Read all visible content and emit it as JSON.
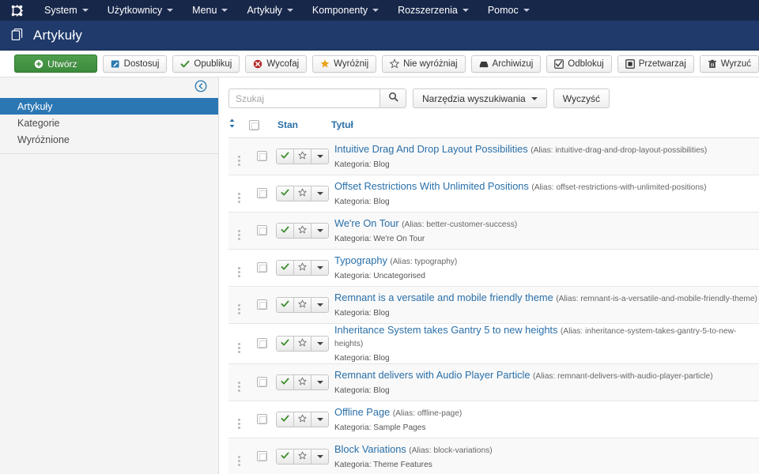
{
  "topbar": {
    "logo_icon": "joomla-logo-icon",
    "menu": [
      {
        "label": "System",
        "has_caret": true
      },
      {
        "label": "Użytkownicy",
        "has_caret": true
      },
      {
        "label": "Menu",
        "has_caret": true
      },
      {
        "label": "Artykuły",
        "has_caret": true
      },
      {
        "label": "Komponenty",
        "has_caret": true
      },
      {
        "label": "Rozszerzenia",
        "has_caret": true
      },
      {
        "label": "Pomoc",
        "has_caret": true
      }
    ]
  },
  "pageheader": {
    "icon": "articles-stack-icon",
    "title": "Artykuły"
  },
  "toolbar": {
    "new_label": "Utwórz",
    "buttons": [
      {
        "label": "Dostosuj",
        "icon": "edit-icon"
      },
      {
        "label": "Opublikuj",
        "icon": "check-icon"
      },
      {
        "label": "Wycofaj",
        "icon": "cancel-circle-icon"
      },
      {
        "label": "Wyróżnij",
        "icon": "star-filled-icon"
      },
      {
        "label": "Nie wyróżniaj",
        "icon": "star-outline-icon"
      },
      {
        "label": "Archiwizuj",
        "icon": "archive-box-icon"
      },
      {
        "label": "Odblokuj",
        "icon": "checkbox-icon"
      },
      {
        "label": "Przetwarzaj",
        "icon": "batch-square-icon"
      },
      {
        "label": "Wyrzuć",
        "icon": "trash-icon"
      }
    ]
  },
  "sidebar": {
    "collapse_icon": "collapse-left-arrow-icon",
    "items": [
      {
        "label": "Artykuły",
        "active": true
      },
      {
        "label": "Kategorie",
        "active": false
      },
      {
        "label": "Wyróżnione",
        "active": false
      }
    ]
  },
  "search": {
    "placeholder": "Szukaj",
    "value": "",
    "search_icon": "search-icon",
    "tools_label": "Narzędzia wyszukiwania",
    "clear_label": "Wyczyść"
  },
  "table": {
    "headers": {
      "sort_icon": "sort-updown-icon",
      "select_all": "select-all-checkbox",
      "state": "Stan",
      "title": "Tytuł"
    },
    "alias_prefix": "Alias:",
    "category_prefix": "Kategoria:",
    "rows": [
      {
        "title": "Intuitive Drag And Drop Layout Possibilities",
        "alias": "intuitive-drag-and-drop-layout-possibilities",
        "category": "Blog",
        "published": true,
        "featured": false
      },
      {
        "title": "Offset Restrictions With Unlimited Positions",
        "alias": "offset-restrictions-with-unlimited-positions",
        "category": "Blog",
        "published": true,
        "featured": false
      },
      {
        "title": "We're On Tour",
        "alias": "better-customer-success",
        "category": "We're On Tour",
        "published": true,
        "featured": false
      },
      {
        "title": "Typography",
        "alias": "typography",
        "category": "Uncategorised",
        "published": true,
        "featured": false
      },
      {
        "title": "Remnant is a versatile and mobile friendly theme",
        "alias": "remnant-is-a-versatile-and-mobile-friendly-theme",
        "category": "Blog",
        "published": true,
        "featured": false
      },
      {
        "title": "Inheritance System takes Gantry 5 to new heights",
        "alias": "inheritance-system-takes-gantry-5-to-new-heights",
        "category": "Blog",
        "published": true,
        "featured": false
      },
      {
        "title": "Remnant delivers with Audio Player Particle",
        "alias": "remnant-delivers-with-audio-player-particle",
        "category": "Blog",
        "published": true,
        "featured": false
      },
      {
        "title": "Offline Page",
        "alias": "offline-page",
        "category": "Sample Pages",
        "published": true,
        "featured": false
      },
      {
        "title": "Block Variations",
        "alias": "block-variations",
        "category": "Theme Features",
        "published": true,
        "featured": false
      }
    ]
  },
  "colors": {
    "topbar_bg": "#17274a",
    "header_bg": "#1f3a6b",
    "accent_blue": "#2a6fa8",
    "sidebar_active": "#2b77b4",
    "new_button_green": "#3c8a3c",
    "check_green": "#3f8f2f",
    "cancel_red": "#b42b2b",
    "star_orange": "#e8a317"
  }
}
